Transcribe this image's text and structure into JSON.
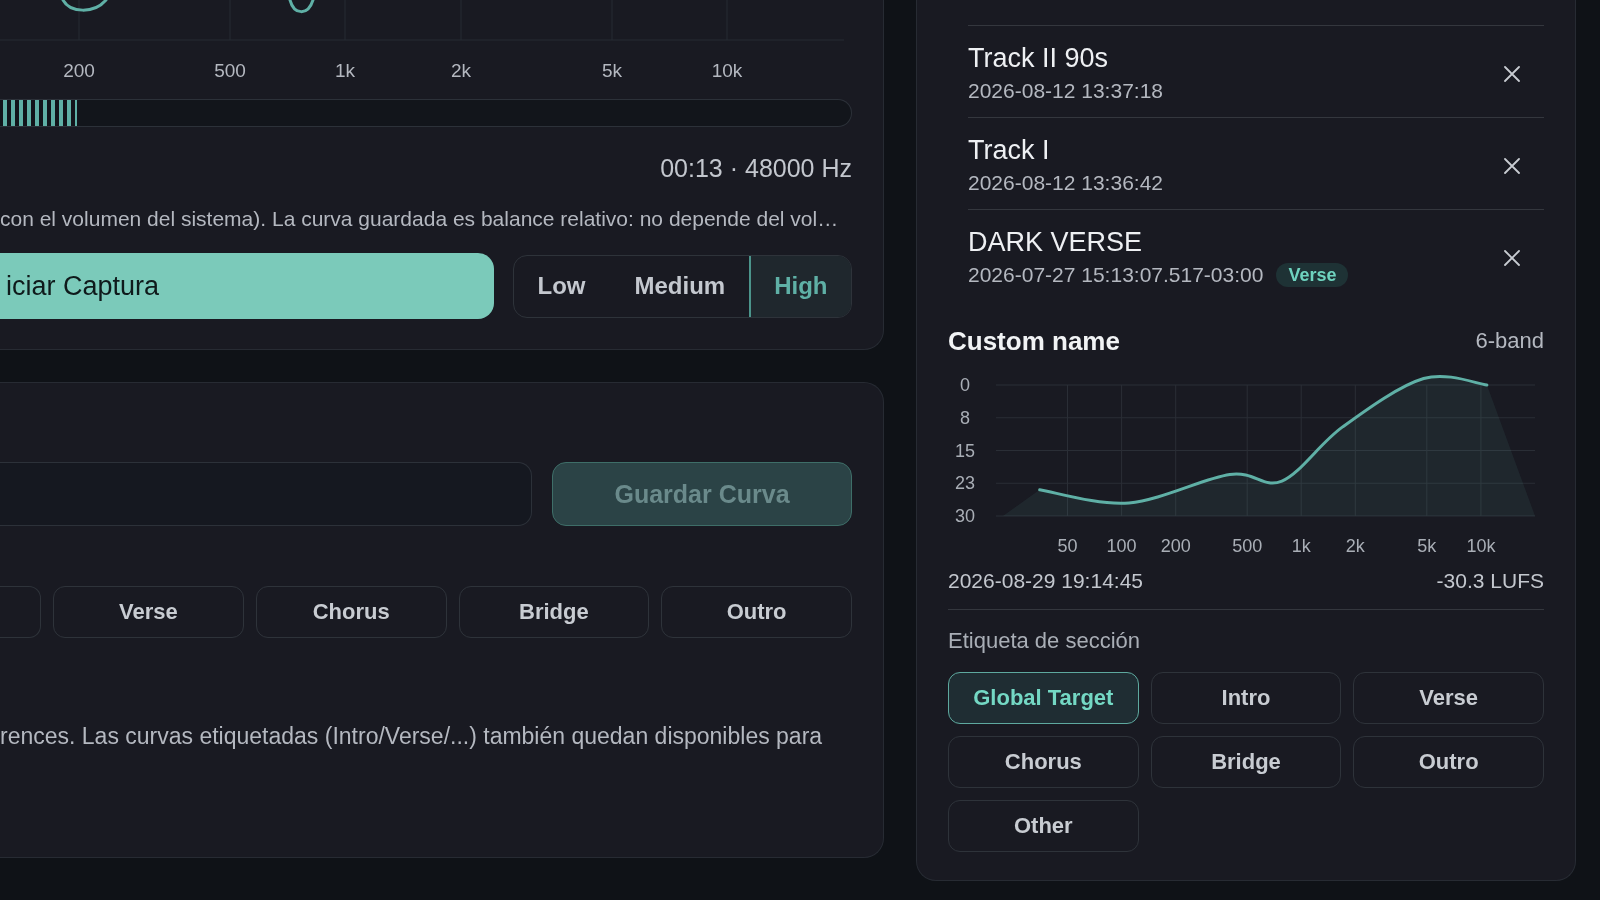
{
  "spectrum": {
    "x_labels": [
      "200",
      "500",
      "1k",
      "2k",
      "5k",
      "10k"
    ]
  },
  "meter": {
    "level": 0.09
  },
  "capture_info": "00:13 · 48000 Hz",
  "note": "con el volumen del sistema). La curva guardada es balance relativo: no depende del vol…",
  "capture_button": {
    "label": "iciar Captura"
  },
  "quality": [
    {
      "label": "Low",
      "selected": false
    },
    {
      "label": "Medium",
      "selected": false
    },
    {
      "label": "High",
      "selected": true
    }
  ],
  "save_button": {
    "label": "Guardar Curva",
    "disabled": true
  },
  "tags": [
    {
      "kind": "clipped",
      "selected": false
    },
    {
      "kind": "full",
      "label": "Verse",
      "selected": false
    },
    {
      "kind": "full",
      "label": "Chorus",
      "selected": false
    },
    {
      "kind": "full",
      "label": "Bridge",
      "selected": false
    },
    {
      "kind": "full",
      "label": "Outro",
      "selected": false
    }
  ],
  "help_text": "rences. Las curvas etiquetadas (Intro/Verse/...) también quedan disponibles para",
  "tracks": [
    {
      "title": "Track II 90s",
      "date": "2026-08-12 13:37:18"
    },
    {
      "title": "Track I",
      "date": "2026-08-12 13:36:42"
    },
    {
      "title": "DARK VERSE",
      "date": "2026-07-27 15:13:07.517-03:00",
      "badge": "Verse"
    }
  ],
  "preview": {
    "title": "Custom name",
    "bands": "6-band",
    "curve": {
      "y_labels": [
        "0",
        "8",
        "15",
        "23",
        "30"
      ],
      "x_labels": [
        "50",
        "100",
        "200",
        "500",
        "1k",
        "2k",
        "5k",
        "10k"
      ]
    },
    "date": "2026-08-29 19:14:45",
    "loudness": "-30.3 LUFS"
  },
  "section_tags": {
    "heading": "Etiqueta de sección",
    "options": [
      {
        "label": "Global Target",
        "selected": true
      },
      {
        "label": "Intro",
        "selected": false
      },
      {
        "label": "Verse",
        "selected": false
      },
      {
        "label": "Chorus",
        "selected": false
      },
      {
        "label": "Bridge",
        "selected": false
      },
      {
        "label": "Outro",
        "selected": false
      },
      {
        "label": "Other",
        "selected": false
      }
    ]
  }
}
